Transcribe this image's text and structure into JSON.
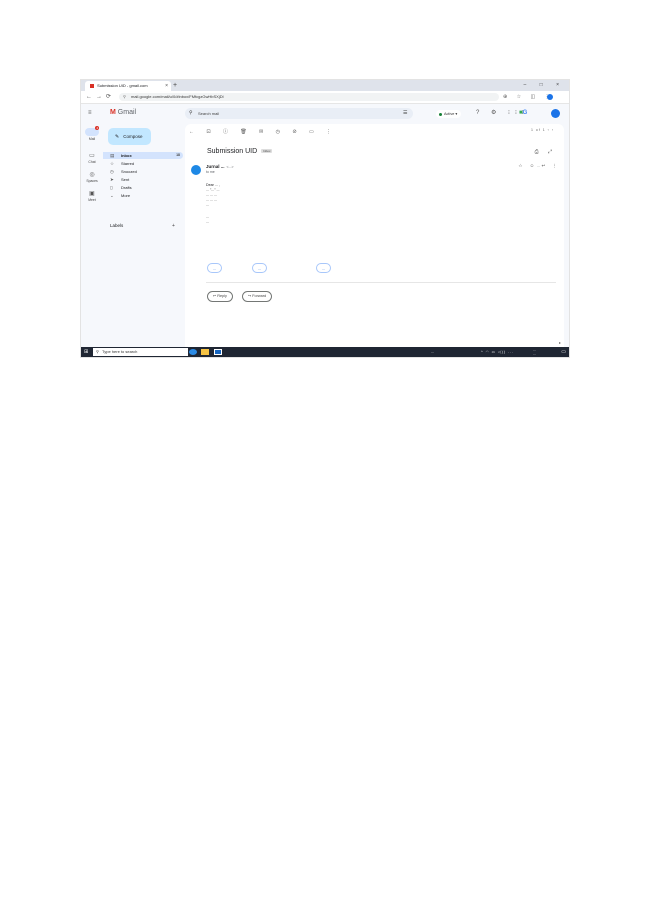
{
  "browser": {
    "tab_title": "Submission UID - gmail.com",
    "tab_close": "×",
    "new_tab": "+",
    "window_controls": "– □ ×",
    "url": "mail.google.com/mail/u/0/#inbox/FMfcgzGwHbSXjDl",
    "nav": {
      "back": "←",
      "forward": "→",
      "reload": "⟳"
    },
    "actions": "⊕ ☆ ◫ ⋮"
  },
  "gmail": {
    "logo": "Gmail",
    "rail": [
      {
        "icon": "✉",
        "label": "Mail",
        "badge": "4"
      },
      {
        "icon": "▭",
        "label": "Chat"
      },
      {
        "icon": "◎",
        "label": "Spaces"
      },
      {
        "icon": "▣",
        "label": "Meet"
      }
    ],
    "compose": "Compose",
    "nav": [
      {
        "icon": "▤",
        "label": "Inbox",
        "count": "18",
        "active": true
      },
      {
        "icon": "☆",
        "label": "Starred"
      },
      {
        "icon": "◷",
        "label": "Snoozed"
      },
      {
        "icon": "➤",
        "label": "Sent"
      },
      {
        "icon": "▯",
        "label": "Drafts"
      },
      {
        "icon": "⌄",
        "label": "More"
      }
    ],
    "labels": "Labels",
    "labels_add": "+",
    "search_placeholder": "Search mail",
    "status": "Active",
    "top_icons": "? ⚙ ⁝⁝⁝",
    "brand_text": "G",
    "pager": "1 of 1  ‹  ›"
  },
  "message": {
    "toolbar": "←  ⊡  ⓘ  🗑  ✉  ◷  ⊘  ▭  ⋮",
    "subject": "Submission UID",
    "subject_tag": "Inbox",
    "subject_icons": "⎙ ⤢",
    "sender_name": "Jurnal ...",
    "sender_email": "<...>",
    "to": "to me",
    "date": "...",
    "message_icons": "☆ ☺ ↩ ⋮",
    "body": [
      "Dear ... ,",
      "... \"...\" ...",
      "... ... ...",
      "... ... ...",
      "..."
    ],
    "signature": [
      "...",
      "..."
    ],
    "smart_replies": [
      "...",
      "...",
      "..."
    ],
    "reply": "↩ Reply",
    "forward": "↪ Forward"
  },
  "taskbar": {
    "start": "⊞",
    "search_placeholder": "Type here to search",
    "weather": "...",
    "tray": "^ ◠ ▭ ◁)) ...",
    "time": "...",
    "date": "...",
    "notifications": "▭"
  },
  "colors": {
    "accent": "#1a73e8",
    "compose_bg": "#c2e7ff",
    "active_nav": "#d3e3fd",
    "gmail_red": "#d93025",
    "taskbar": "#1f2633"
  }
}
